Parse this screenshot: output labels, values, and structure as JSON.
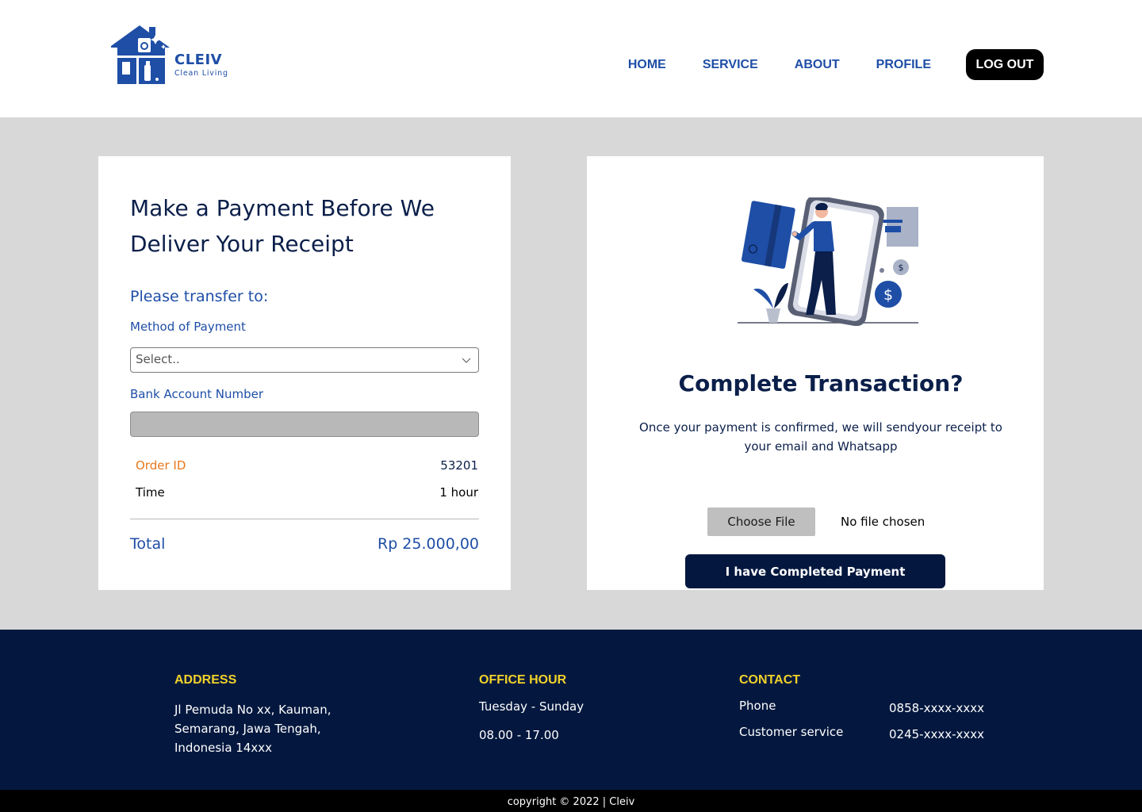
{
  "brand": {
    "name": "CLEIV",
    "tagline": "Clean Living",
    "primary_color": "#1e4ea6",
    "dark_color": "#04183f",
    "accent_color": "#f2d22a",
    "order_color": "#e8771c"
  },
  "nav": {
    "items": [
      "HOME",
      "SERVICE",
      "ABOUT",
      "PROFILE"
    ],
    "logout_label": "LOG OUT"
  },
  "payment": {
    "title": "Make a Payment Before We Deliver Your Receipt",
    "transfer_heading": "Please transfer to:",
    "method_label": "Method of Payment",
    "method_value": "Select..",
    "bank_label": "Bank Account Number",
    "bank_value": "",
    "order_id_label": "Order ID",
    "order_id_value": "53201",
    "time_label": "Time",
    "time_value": "1 hour",
    "total_label": "Total",
    "total_value": "Rp 25.000,00"
  },
  "confirm": {
    "illustration": "person-stepping-out-of-phone-payment-illustration",
    "title": "Complete Transaction?",
    "text": "Once your payment is confirmed, we will sendyour receipt to your email and Whatsapp",
    "choose_file_label": "Choose File",
    "file_status": "No file chosen",
    "submit_label": "I have Completed Payment"
  },
  "footer": {
    "address_heading": "ADDRESS",
    "address_lines": [
      "Jl Pemuda  No xx, Kauman,",
      "Semarang, Jawa Tengah,",
      "Indonesia 14xxx"
    ],
    "office_heading": "OFFICE HOUR",
    "office_days": "Tuesday - Sunday",
    "office_hours": "08.00 - 17.00",
    "contact_heading": "CONTACT",
    "contacts": [
      {
        "label": "Phone",
        "value": "0858-xxxx-xxxx"
      },
      {
        "label": "Customer service",
        "value": "0245-xxxx-xxxx"
      }
    ],
    "copyright": "copyright © 2022 | Cleiv"
  }
}
